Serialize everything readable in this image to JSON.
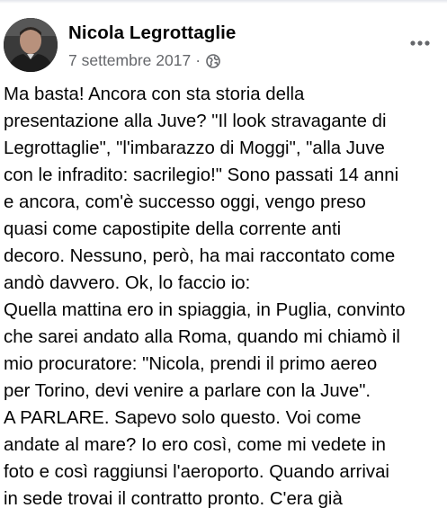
{
  "post": {
    "author": "Nicola Legrottaglie",
    "date": "7 settembre 2017",
    "separator": "·",
    "audience_icon": "globe-icon",
    "more_icon": "more-dots-icon",
    "lines": [
      "Ma basta! Ancora con sta storia della",
      "presentazione alla Juve? \"Il look stravagante di",
      "Legrottaglie\", \"l'imbarazzo di Moggi\", \"alla Juve",
      "con le infradito: sacrilegio!\" Sono passati 14 anni",
      "e ancora, com'è successo oggi, vengo preso",
      "quasi come capostipite della corrente anti",
      "decoro. Nessuno, però, ha mai raccontato come",
      "andò davvero. Ok, lo faccio io:",
      "Quella mattina ero in spiaggia, in Puglia, convinto",
      "che sarei andato alla Roma, quando mi chiamò il",
      "mio procuratore: \"Nicola, prendi il primo aereo",
      "per Torino, devi venire a parlare con la Juve\".",
      "A PARLARE. Sapevo solo questo. Voi come",
      "andate al mare? Io ero così, come mi vedete in",
      "foto e così raggiunsi l'aeroporto. Quando arrivai",
      "in sede trovai il contratto pronto. C'era già"
    ]
  },
  "colors": {
    "text": "#050505",
    "secondary_text": "#65676b",
    "background": "#ffffff"
  }
}
